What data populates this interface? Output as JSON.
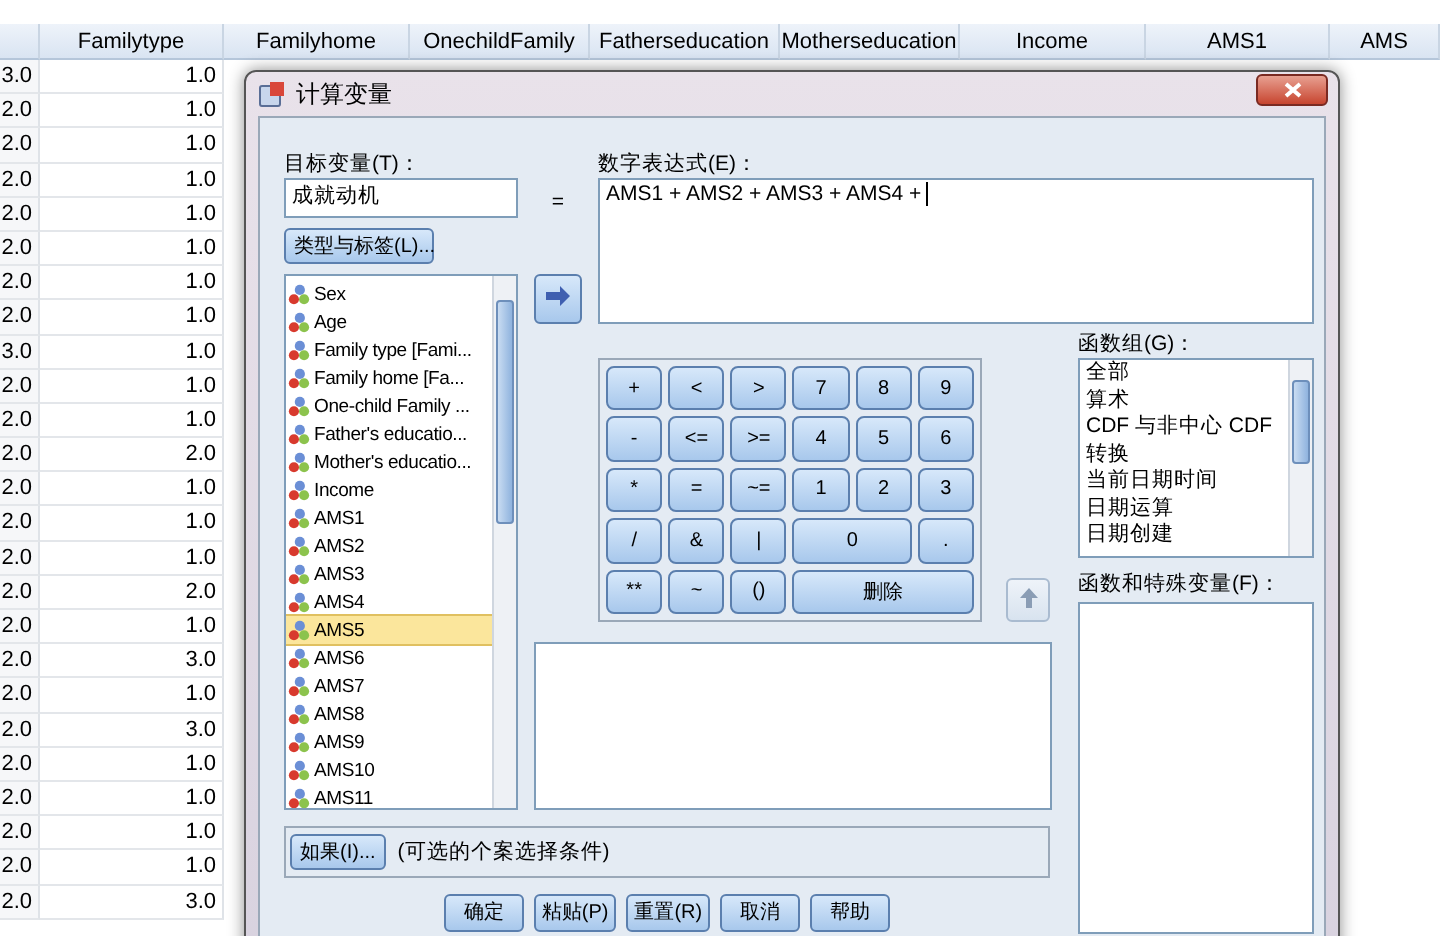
{
  "grid": {
    "columns": [
      "",
      "Familytype",
      "Familyhome",
      "OnechildFamily",
      "Fatherseducation",
      "Motherseducation",
      "Income",
      "AMS1",
      "AMS"
    ],
    "rows": [
      [
        "3.0",
        "1.0"
      ],
      [
        "2.0",
        "1.0"
      ],
      [
        "2.0",
        "1.0"
      ],
      [
        "2.0",
        "1.0"
      ],
      [
        "2.0",
        "1.0"
      ],
      [
        "2.0",
        "1.0"
      ],
      [
        "2.0",
        "1.0"
      ],
      [
        "2.0",
        "1.0"
      ],
      [
        "3.0",
        "1.0"
      ],
      [
        "2.0",
        "1.0"
      ],
      [
        "2.0",
        "1.0"
      ],
      [
        "2.0",
        "2.0"
      ],
      [
        "2.0",
        "1.0"
      ],
      [
        "2.0",
        "1.0"
      ],
      [
        "2.0",
        "1.0"
      ],
      [
        "2.0",
        "2.0"
      ],
      [
        "2.0",
        "1.0"
      ],
      [
        "2.0",
        "3.0"
      ],
      [
        "2.0",
        "1.0"
      ],
      [
        "2.0",
        "3.0"
      ],
      [
        "2.0",
        "1.0"
      ],
      [
        "2.0",
        "1.0"
      ],
      [
        "2.0",
        "1.0"
      ],
      [
        "2.0",
        "1.0"
      ],
      [
        "2.0",
        "3.0"
      ]
    ]
  },
  "dialog": {
    "title": "计算变量",
    "target_label": "目标变量(T)：",
    "target_value": "成就动机",
    "equals": "=",
    "type_button": "类型与标签(L)...",
    "expression_label": "数字表达式(E)：",
    "expression_value": "AMS1 + AMS2 + AMS3 + AMS4 +",
    "move_button": {
      "disabled": false
    },
    "variables": [
      {
        "name": "Sex",
        "selected": false
      },
      {
        "name": "Age",
        "selected": false
      },
      {
        "name": "Family type [Fami...",
        "selected": false
      },
      {
        "name": "Family home [Fa...",
        "selected": false
      },
      {
        "name": "One-child Family ...",
        "selected": false
      },
      {
        "name": "Father's educatio...",
        "selected": false
      },
      {
        "name": "Mother's educatio...",
        "selected": false
      },
      {
        "name": "Income",
        "selected": false
      },
      {
        "name": "AMS1",
        "selected": false
      },
      {
        "name": "AMS2",
        "selected": false
      },
      {
        "name": "AMS3",
        "selected": false
      },
      {
        "name": "AMS4",
        "selected": false
      },
      {
        "name": "AMS5",
        "selected": true
      },
      {
        "name": "AMS6",
        "selected": false
      },
      {
        "name": "AMS7",
        "selected": false
      },
      {
        "name": "AMS8",
        "selected": false
      },
      {
        "name": "AMS9",
        "selected": false
      },
      {
        "name": "AMS10",
        "selected": false
      },
      {
        "name": "AMS11",
        "selected": false
      }
    ],
    "keys": [
      {
        "label": "+",
        "kind": "single"
      },
      {
        "label": "<",
        "kind": "single"
      },
      {
        "label": ">",
        "kind": "single"
      },
      {
        "label": "7",
        "kind": "single"
      },
      {
        "label": "8",
        "kind": "single"
      },
      {
        "label": "9",
        "kind": "single"
      },
      {
        "label": "-",
        "kind": "single"
      },
      {
        "label": "<=",
        "kind": "single"
      },
      {
        "label": ">=",
        "kind": "single"
      },
      {
        "label": "4",
        "kind": "single"
      },
      {
        "label": "5",
        "kind": "single"
      },
      {
        "label": "6",
        "kind": "single"
      },
      {
        "label": "*",
        "kind": "single"
      },
      {
        "label": "=",
        "kind": "single"
      },
      {
        "label": "~=",
        "kind": "single"
      },
      {
        "label": "1",
        "kind": "single"
      },
      {
        "label": "2",
        "kind": "single"
      },
      {
        "label": "3",
        "kind": "single"
      },
      {
        "label": "/",
        "kind": "single"
      },
      {
        "label": "&",
        "kind": "single"
      },
      {
        "label": "|",
        "kind": "single"
      },
      {
        "label": "0",
        "kind": "double"
      },
      {
        "label": ".",
        "kind": "single"
      },
      {
        "label": "**",
        "kind": "single"
      },
      {
        "label": "~",
        "kind": "single"
      },
      {
        "label": "()",
        "kind": "single"
      },
      {
        "label": "删除",
        "kind": "triple"
      }
    ],
    "up_button": {
      "disabled": true
    },
    "function_group_label": "函数组(G)：",
    "function_groups": [
      {
        "name": "全部",
        "selected": false
      },
      {
        "name": "算术",
        "selected": false
      },
      {
        "name": "CDF 与非中心 CDF",
        "selected": false
      },
      {
        "name": "转换",
        "selected": false
      },
      {
        "name": "当前日期时间",
        "selected": false
      },
      {
        "name": "日期运算",
        "selected": false
      },
      {
        "name": "日期创建",
        "selected": false
      }
    ],
    "functions_label": "函数和特殊变量(F)：",
    "if_button": "如果(I)...",
    "if_hint": "(可选的个案选择条件)",
    "buttons": [
      "确定",
      "粘贴(P)",
      "重置(R)",
      "取消",
      "帮助"
    ]
  }
}
